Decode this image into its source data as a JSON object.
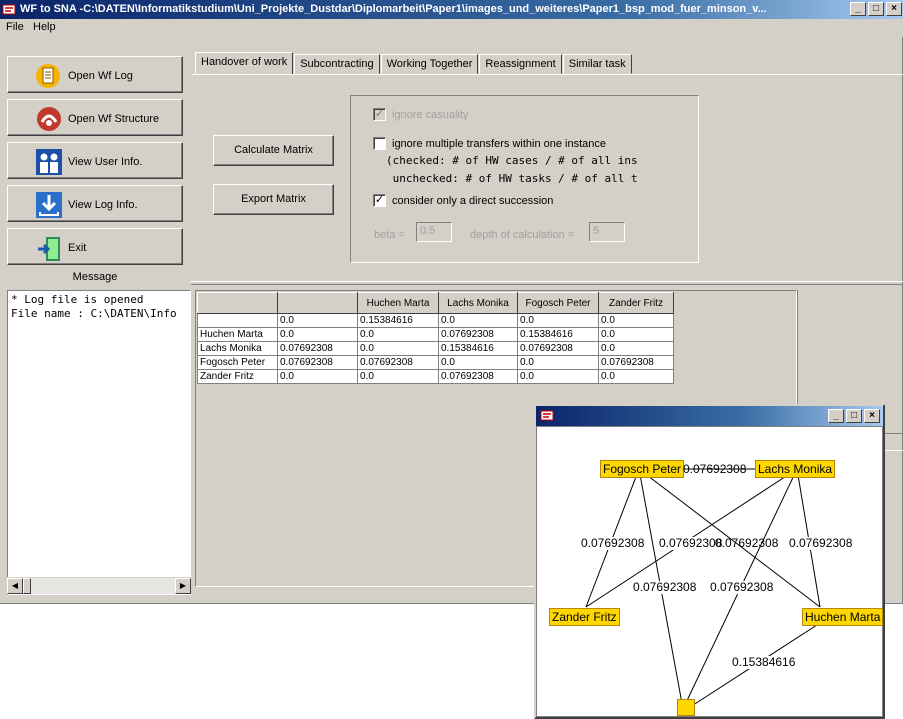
{
  "window": {
    "title": "WF to SNA -C:\\DATEN\\Informatikstudium\\Uni_Projekte_Dustdar\\Diplomarbeit\\Paper1\\images_und_weiteres\\Paper1_bsp_mod_fuer_minson_v...",
    "min": "_",
    "max": "□",
    "close": "×"
  },
  "menu": [
    "File",
    "Help"
  ],
  "sidebar": {
    "buttons": [
      "Open Wf Log",
      "Open Wf Structure",
      "View User Info.",
      "View Log Info.",
      "Exit"
    ],
    "icons": [
      "log-icon",
      "structure-icon",
      "users-icon",
      "download-icon",
      "exit-icon"
    ],
    "message_label": "Message",
    "log_lines": [
      "* Log file is opened",
      "File name : C:\\DATEN\\Info"
    ]
  },
  "tabs": [
    "Handover of work",
    "Subcontracting",
    "Working Together",
    "Reassignment",
    "Similar task"
  ],
  "actions": {
    "calculate": "Calculate Matrix",
    "export": "Export Matrix"
  },
  "options": {
    "ignore_casuality": "ignore casuality",
    "ignore_multiple": "ignore multiple transfers within one instance",
    "note1": "(checked: # of HW cases / # of all ins",
    "note2": " unchecked: # of HW tasks / # of all t",
    "direct_succession": "consider only a direct succession",
    "beta_label": "beta =",
    "beta_value": "0.5",
    "depth_label": "depth of calculation =",
    "depth_value": "5"
  },
  "matrix": {
    "headers": [
      "",
      "",
      "Huchen Marta",
      "Lachs Monika",
      "Fogosch Peter",
      "Zander Fritz"
    ],
    "rows": [
      [
        "",
        "0.0",
        "0.15384616",
        "0.0",
        "0.0",
        "0.0"
      ],
      [
        "Huchen Marta",
        "0.0",
        "0.0",
        "0.07692308",
        "0.15384616",
        "0.0"
      ],
      [
        "Lachs Monika",
        "0.07692308",
        "0.0",
        "0.15384616",
        "0.07692308",
        "0.0"
      ],
      [
        "Fogosch Peter",
        "0.07692308",
        "0.07692308",
        "0.0",
        "0.0",
        "0.07692308"
      ],
      [
        "Zander Fritz",
        "0.0",
        "0.0",
        "0.07692308",
        "0.0",
        "0.0"
      ]
    ]
  },
  "graph": {
    "nodes": [
      "Fogosch Peter",
      "Lachs Monika",
      "Zander Fritz",
      "Huchen Marta",
      ""
    ],
    "edge_labels": [
      "0.07692308",
      "0.07692308",
      "0.07692308",
      "0.07692308",
      "0.07692308",
      "0.07692308",
      "0.07692308",
      "0.15384616"
    ],
    "node_color": "#ffd700"
  }
}
